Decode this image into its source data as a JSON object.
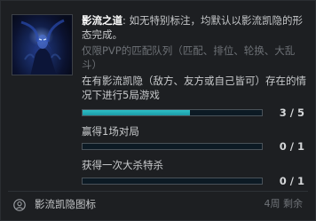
{
  "challenge": {
    "hero_image_name": "shadow-hero-portrait",
    "title": "影流之道",
    "description": ": 如无特别标注，均默认以影流凯隐的形态完成。",
    "restriction": "仅限PVP的匹配队列（匹配、排位、轮换、大乱斗）",
    "tasks": [
      {
        "text": "在有影流凯隐（敌方、友方或自己皆可）存在的情况下进行5局游戏",
        "count": "3 / 5",
        "progress": 0.6
      },
      {
        "text": "赢得1场对局",
        "count": "0 / 1",
        "progress": 0
      },
      {
        "text": "获得一次大杀特杀",
        "count": "0 / 1",
        "progress": 0
      }
    ]
  },
  "footer": {
    "reward_icon": "user-circle-icon",
    "reward_label": "影流凯隐图标",
    "time_left": "4周 剩余"
  },
  "colors": {
    "progress_fill": "#2dbfc7",
    "progress_track": "#0c1a24",
    "background": "#1d1f22",
    "title": "#ffffff",
    "muted": "#6d7176"
  }
}
